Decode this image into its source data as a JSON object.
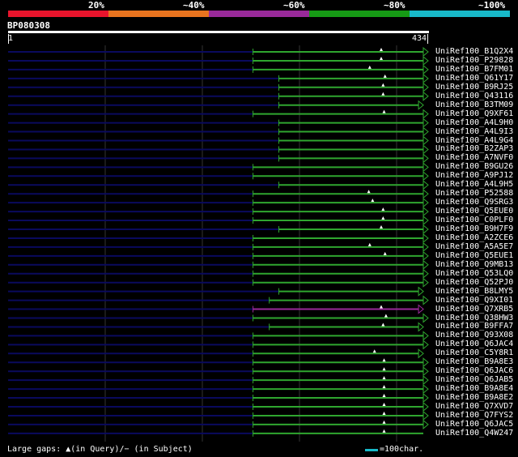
{
  "scale": {
    "segments": [
      {
        "label": "20%",
        "color": "#e8142c"
      },
      {
        "label": "~40%",
        "color": "#e8741f"
      },
      {
        "label": "~60%",
        "color": "#992a9a"
      },
      {
        "label": "~80%",
        "color": "#169a15"
      },
      {
        "label": "~100%",
        "color": "#18b9c9"
      }
    ]
  },
  "query": {
    "name": "BP080308",
    "start": "1",
    "end": "434",
    "length": 434
  },
  "colors": {
    "unaligned": "#0a0a5e",
    "grid": "#333333",
    "identity_80": "#2fa62f",
    "identity_60": "#992a9a",
    "marker": "#ffffff"
  },
  "hits": [
    {
      "id": "UniRef100_B1Q2X4",
      "qstart": 256,
      "qend": 434,
      "color": "identity_80",
      "gap": 390,
      "end_arrow": true
    },
    {
      "id": "UniRef100_P29828",
      "qstart": 256,
      "qend": 434,
      "color": "identity_80",
      "gap": 390,
      "end_arrow": true
    },
    {
      "id": "UniRef100_B7FM01",
      "qstart": 256,
      "qend": 434,
      "color": "identity_80",
      "gap": 378,
      "end_arrow": true
    },
    {
      "id": "UniRef100_Q61Y17",
      "qstart": 283,
      "qend": 434,
      "color": "identity_80",
      "gap": 394,
      "end_arrow": true
    },
    {
      "id": "UniRef100_B9RJ25",
      "qstart": 283,
      "qend": 434,
      "color": "identity_80",
      "gap": 392,
      "end_arrow": true
    },
    {
      "id": "UniRef100_Q43116",
      "qstart": 283,
      "qend": 434,
      "color": "identity_80",
      "gap": 392,
      "end_arrow": true
    },
    {
      "id": "UniRef100_B3TM09",
      "qstart": 283,
      "qend": 429,
      "color": "identity_80",
      "gap": 0,
      "end_arrow": true
    },
    {
      "id": "UniRef100_Q9XF61",
      "qstart": 256,
      "qend": 434,
      "color": "identity_80",
      "gap": 393,
      "end_arrow": true
    },
    {
      "id": "UniRef100_A4L9H0",
      "qstart": 283,
      "qend": 434,
      "color": "identity_80",
      "gap": 0,
      "end_arrow": true
    },
    {
      "id": "UniRef100_A4L9I3",
      "qstart": 283,
      "qend": 434,
      "color": "identity_80",
      "gap": 0,
      "end_arrow": true
    },
    {
      "id": "UniRef100_A4L9G4",
      "qstart": 283,
      "qend": 434,
      "color": "identity_80",
      "gap": 0,
      "end_arrow": true
    },
    {
      "id": "UniRef100_B2ZAP3",
      "qstart": 283,
      "qend": 434,
      "color": "identity_80",
      "gap": 0,
      "end_arrow": true
    },
    {
      "id": "UniRef100_A7NVF0",
      "qstart": 283,
      "qend": 434,
      "color": "identity_80",
      "gap": 0,
      "end_arrow": true
    },
    {
      "id": "UniRef100_B9GU26",
      "qstart": 256,
      "qend": 434,
      "color": "identity_80",
      "gap": 0,
      "end_arrow": true
    },
    {
      "id": "UniRef100_A9PJ12",
      "qstart": 256,
      "qend": 434,
      "color": "identity_80",
      "gap": 0,
      "end_arrow": true
    },
    {
      "id": "UniRef100_A4L9H5",
      "qstart": 283,
      "qend": 434,
      "color": "identity_80",
      "gap": 0,
      "end_arrow": true
    },
    {
      "id": "UniRef100_P52588",
      "qstart": 256,
      "qend": 434,
      "color": "identity_80",
      "gap": 377,
      "end_arrow": true
    },
    {
      "id": "UniRef100_Q9SRG3",
      "qstart": 256,
      "qend": 434,
      "color": "identity_80",
      "gap": 381,
      "end_arrow": true
    },
    {
      "id": "UniRef100_Q5EUE0",
      "qstart": 256,
      "qend": 434,
      "color": "identity_80",
      "gap": 392,
      "end_arrow": true
    },
    {
      "id": "UniRef100_C0PLF0",
      "qstart": 256,
      "qend": 434,
      "color": "identity_80",
      "gap": 392,
      "end_arrow": true
    },
    {
      "id": "UniRef100_B9H7F9",
      "qstart": 283,
      "qend": 434,
      "color": "identity_80",
      "gap": 390,
      "end_arrow": true
    },
    {
      "id": "UniRef100_A2ZCE6",
      "qstart": 256,
      "qend": 434,
      "color": "identity_80",
      "gap": 0,
      "end_arrow": true
    },
    {
      "id": "UniRef100_A5A5E7",
      "qstart": 256,
      "qend": 434,
      "color": "identity_80",
      "gap": 378,
      "end_arrow": true
    },
    {
      "id": "UniRef100_Q5EUE1",
      "qstart": 256,
      "qend": 434,
      "color": "identity_80",
      "gap": 394,
      "end_arrow": true
    },
    {
      "id": "UniRef100_Q9MB13",
      "qstart": 256,
      "qend": 434,
      "color": "identity_80",
      "gap": 0,
      "end_arrow": true
    },
    {
      "id": "UniRef100_Q53LQ0",
      "qstart": 256,
      "qend": 434,
      "color": "identity_80",
      "gap": 0,
      "end_arrow": true
    },
    {
      "id": "UniRef100_Q52PJ0",
      "qstart": 256,
      "qend": 434,
      "color": "identity_80",
      "gap": 0,
      "end_arrow": true
    },
    {
      "id": "UniRef100_B8LMY5",
      "qstart": 283,
      "qend": 429,
      "color": "identity_80",
      "gap": 0,
      "end_arrow": true
    },
    {
      "id": "UniRef100_Q9XI01",
      "qstart": 273,
      "qend": 434,
      "color": "identity_80",
      "gap": 0,
      "end_arrow": true
    },
    {
      "id": "UniRef100_Q7XRB5",
      "qstart": 256,
      "qend": 429,
      "color": "identity_60",
      "gap": 390,
      "end_arrow": true
    },
    {
      "id": "UniRef100_Q38HW3",
      "qstart": 256,
      "qend": 434,
      "color": "identity_80",
      "gap": 395,
      "end_arrow": true
    },
    {
      "id": "UniRef100_B9FFA7",
      "qstart": 273,
      "qend": 429,
      "color": "identity_80",
      "gap": 392,
      "end_arrow": true
    },
    {
      "id": "UniRef100_Q93X08",
      "qstart": 256,
      "qend": 434,
      "color": "identity_80",
      "gap": 0,
      "end_arrow": true
    },
    {
      "id": "UniRef100_Q6JAC4",
      "qstart": 256,
      "qend": 434,
      "color": "identity_80",
      "gap": 0,
      "end_arrow": true
    },
    {
      "id": "UniRef100_C5Y8R1",
      "qstart": 256,
      "qend": 429,
      "color": "identity_80",
      "gap": 383,
      "end_arrow": true
    },
    {
      "id": "UniRef100_B9A8E3",
      "qstart": 256,
      "qend": 434,
      "color": "identity_80",
      "gap": 393,
      "end_arrow": true
    },
    {
      "id": "UniRef100_Q6JAC6",
      "qstart": 256,
      "qend": 434,
      "color": "identity_80",
      "gap": 393,
      "end_arrow": true
    },
    {
      "id": "UniRef100_Q6JAB5",
      "qstart": 256,
      "qend": 434,
      "color": "identity_80",
      "gap": 393,
      "end_arrow": true
    },
    {
      "id": "UniRef100_B9A8E4",
      "qstart": 256,
      "qend": 434,
      "color": "identity_80",
      "gap": 393,
      "end_arrow": true
    },
    {
      "id": "UniRef100_B9A8E2",
      "qstart": 256,
      "qend": 434,
      "color": "identity_80",
      "gap": 393,
      "end_arrow": true
    },
    {
      "id": "UniRef100_Q7XVD7",
      "qstart": 256,
      "qend": 434,
      "color": "identity_80",
      "gap": 393,
      "end_arrow": true
    },
    {
      "id": "UniRef100_Q7FYS2",
      "qstart": 256,
      "qend": 434,
      "color": "identity_80",
      "gap": 393,
      "end_arrow": true
    },
    {
      "id": "UniRef100_Q6JAC5",
      "qstart": 256,
      "qend": 434,
      "color": "identity_80",
      "gap": 393,
      "end_arrow": true
    },
    {
      "id": "UniRef100_Q4W247",
      "qstart": 256,
      "qend": 434,
      "color": "identity_80",
      "gap": 393,
      "end_arrow": false
    }
  ],
  "legend": {
    "gaps_text": "Large gaps: ▲(in Query)/− (in Subject)",
    "scale_text": "=100char."
  }
}
